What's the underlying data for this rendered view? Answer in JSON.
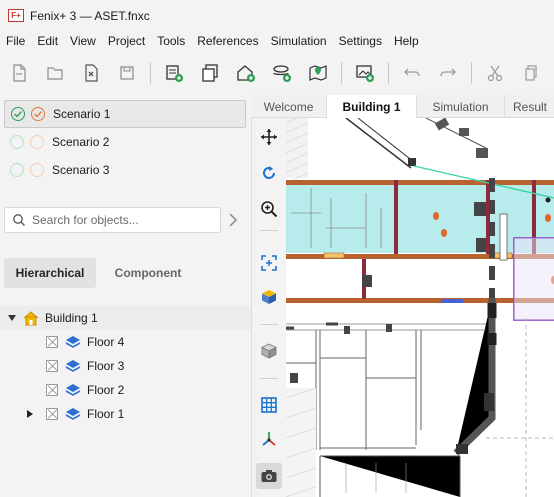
{
  "window": {
    "logo_text": "F+",
    "title": "Fenix+ 3 — ASET.fnxc"
  },
  "menu": [
    "File",
    "Edit",
    "View",
    "Project",
    "Tools",
    "References",
    "Simulation",
    "Settings",
    "Help"
  ],
  "toolbar": {
    "buttons": [
      "new-file-icon",
      "open-folder-icon",
      "close-file-icon",
      "save-icon",
      "add-building-icon",
      "copy-floors-icon",
      "add-home-icon",
      "add-layer-icon",
      "map-pin-icon",
      "add-image-icon",
      "undo-icon",
      "redo-icon",
      "cut-icon",
      "copy-icon"
    ]
  },
  "scenarios": [
    {
      "label": "Scenario 1",
      "active": true
    },
    {
      "label": "Scenario 2",
      "active": false
    },
    {
      "label": "Scenario 3",
      "active": false
    }
  ],
  "search": {
    "placeholder": "Search for objects..."
  },
  "view_tabs": {
    "hierarchical": "Hierarchical",
    "component": "Component"
  },
  "tree": {
    "root": "Building 1",
    "floors": [
      "Floor 4",
      "Floor 3",
      "Floor 2",
      "Floor 1"
    ]
  },
  "doc_tabs": [
    "Welcome",
    "Building 1",
    "Simulation",
    "Result"
  ],
  "vertical_tools": [
    "move-icon",
    "rotate-icon",
    "zoom-icon",
    "fit-view-icon",
    "box-color-icon",
    "box-gray-icon",
    "grid-icon",
    "axes-icon",
    "camera-icon"
  ],
  "colors": {
    "accent_green": "#2e9e55",
    "accent_orange": "#e07b39",
    "room_fill": "#b8ecec",
    "beam": "#b8632f",
    "wall": "#555555",
    "purple_outline": "#8b3fc7"
  }
}
